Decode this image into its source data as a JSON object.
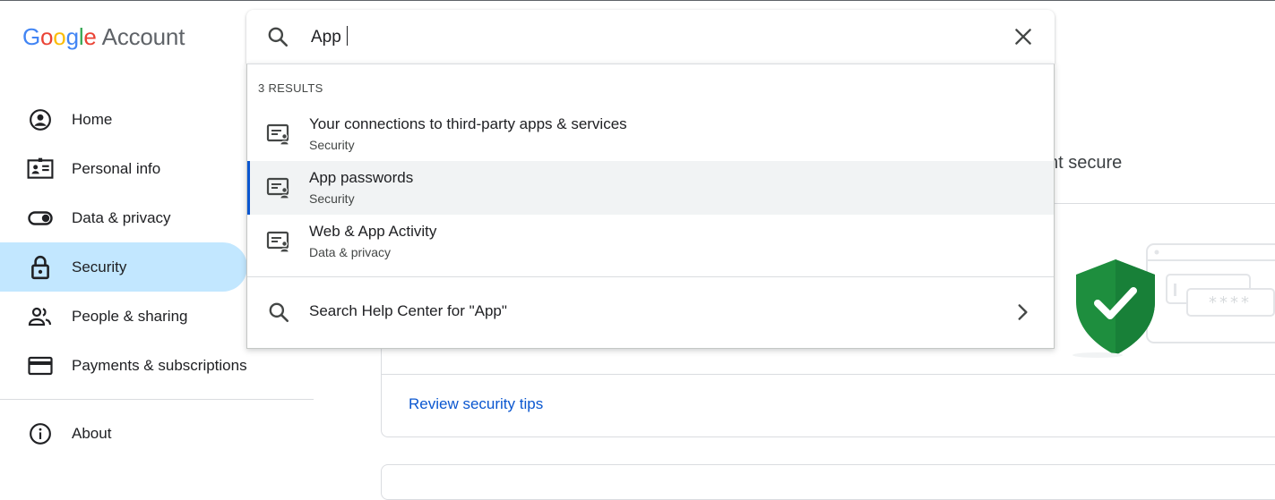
{
  "brand": {
    "google": "Google",
    "account": "Account"
  },
  "nav": {
    "items": [
      {
        "label": "Home",
        "icon": "home-account-icon"
      },
      {
        "label": "Personal info",
        "icon": "id-card-icon"
      },
      {
        "label": "Data & privacy",
        "icon": "toggle-icon"
      },
      {
        "label": "Security",
        "icon": "lock-icon",
        "active": true
      },
      {
        "label": "People & sharing",
        "icon": "people-icon"
      },
      {
        "label": "Payments & subscriptions",
        "icon": "credit-card-icon"
      }
    ],
    "about": {
      "label": "About",
      "icon": "info-icon"
    }
  },
  "search": {
    "value": "App",
    "results_count": "3 RESULTS",
    "results": [
      {
        "title": "Your connections to third-party apps & services",
        "section": "Security"
      },
      {
        "title": "App passwords",
        "section": "Security",
        "highlighted": true
      },
      {
        "title": "Web & App Activity",
        "section": "Data & privacy"
      }
    ],
    "help_label": "Search Help Center for \"App\""
  },
  "background": {
    "subtitle_fragment": "nt secure",
    "review_link": "Review security tips",
    "illustration_text": "****"
  },
  "colors": {
    "accent": "#0b57d0",
    "active_nav": "#c2e7ff",
    "shield_green": "#1e8e3e"
  }
}
